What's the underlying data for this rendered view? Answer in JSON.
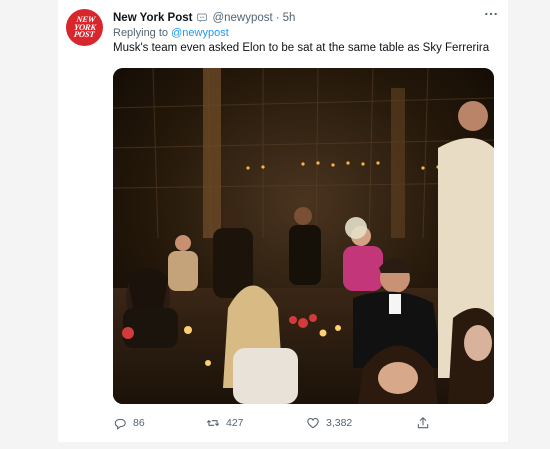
{
  "tweet": {
    "avatar_text": [
      "NEW",
      "YORK",
      "POST"
    ],
    "author_name": "New York Post",
    "author_handle": "@newypost",
    "separator": "·",
    "time": "5h",
    "replying_to_prefix": "Replying to",
    "replying_to_handle": "@newypost",
    "text": "Musk's team even asked Elon to be sat at the same table as Sky Ferrerira",
    "photo_alt": "Photo",
    "actions": {
      "replies": "86",
      "retweets": "427",
      "likes": "3,382"
    }
  },
  "colors": {
    "brand_red": "#d7262c",
    "link_blue": "#1d9bf0",
    "secondary_text": "#536471",
    "background": "#f4f4f4"
  },
  "icons": [
    "more-icon",
    "verified-icon",
    "reply-icon",
    "retweet-icon",
    "like-icon",
    "share-icon"
  ]
}
